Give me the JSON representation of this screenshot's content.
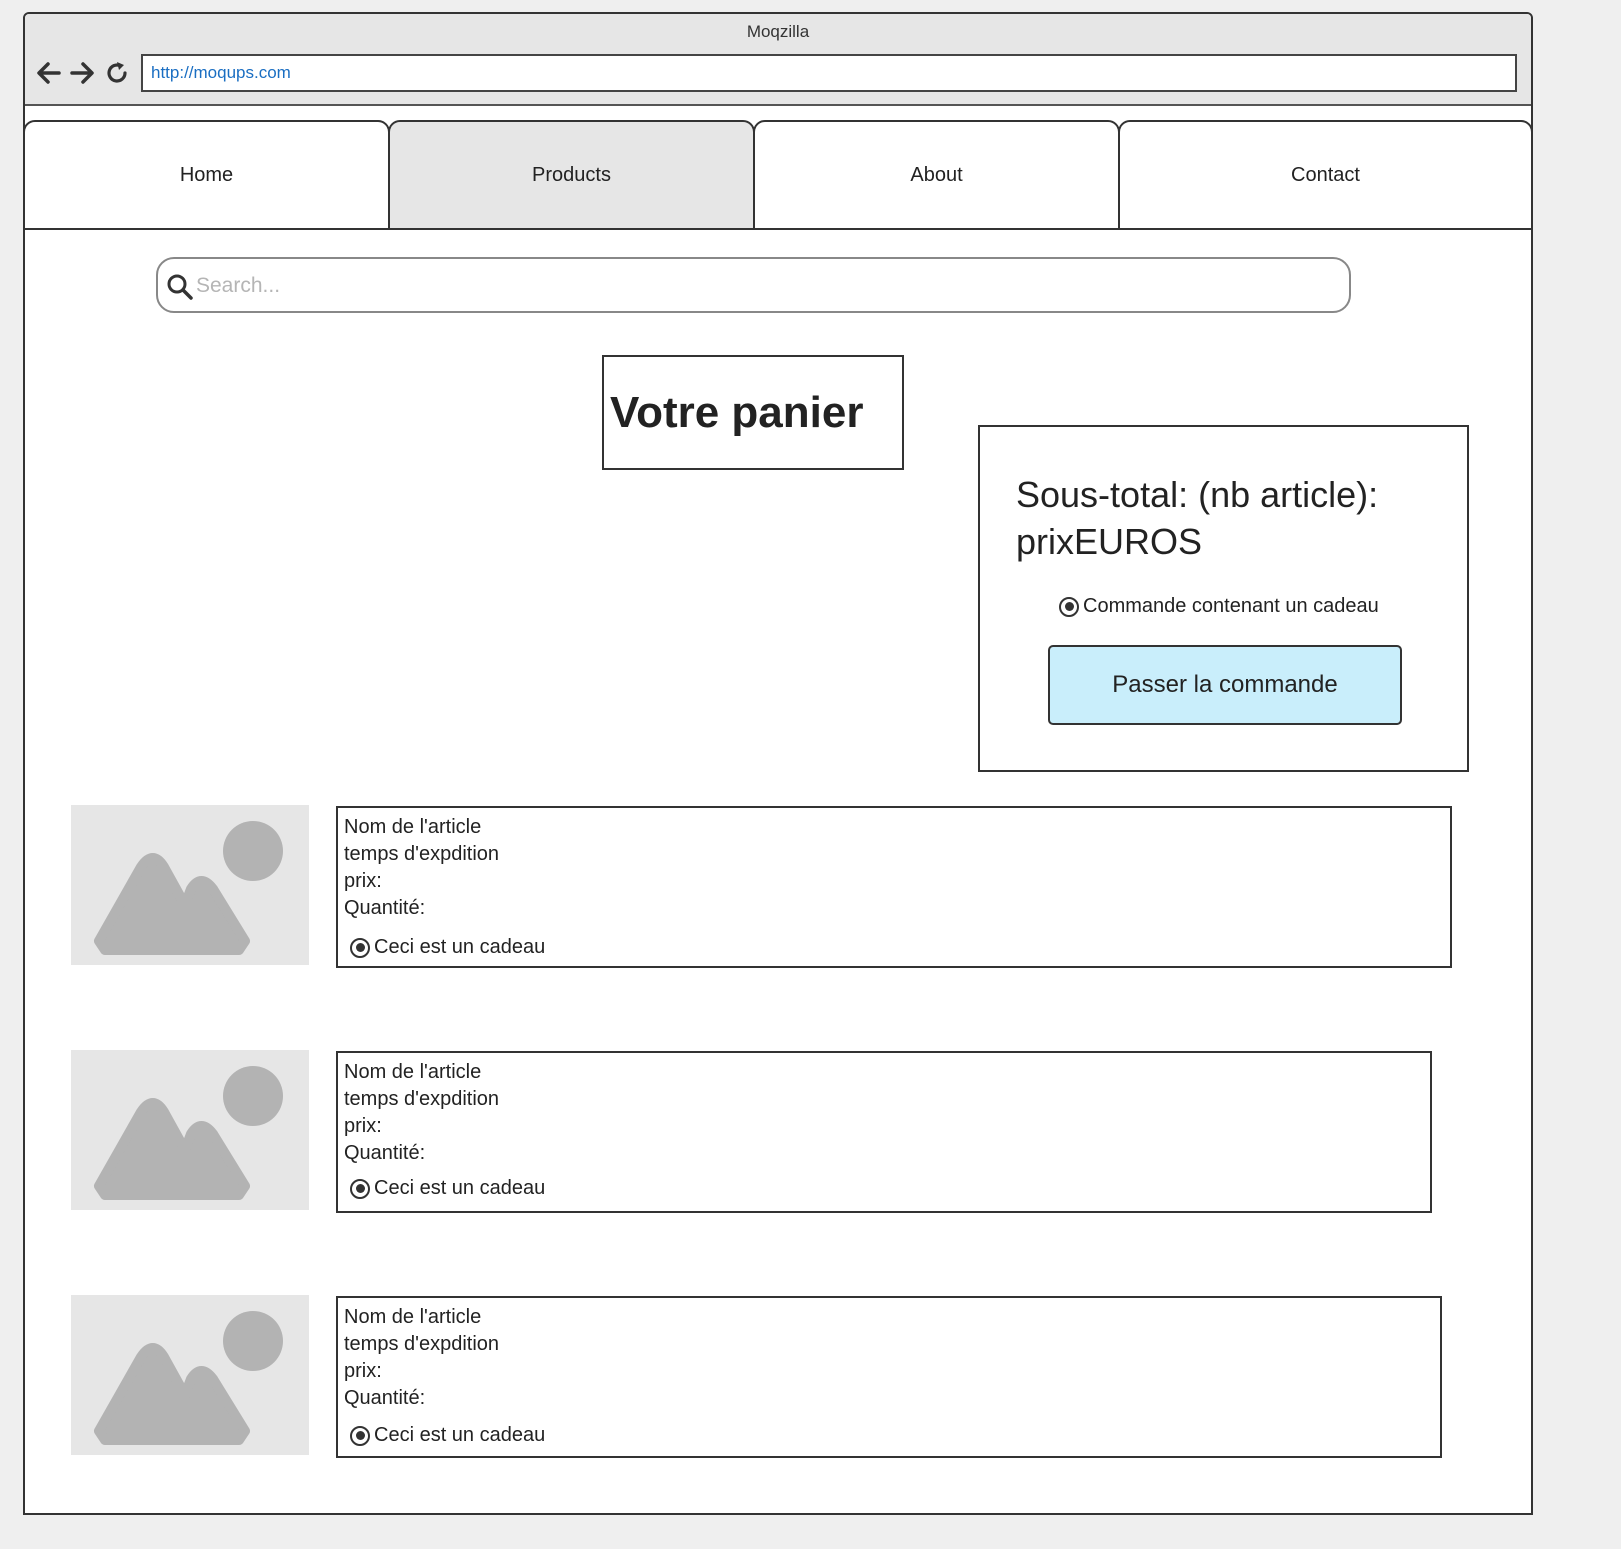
{
  "window": {
    "title": "Moqzilla"
  },
  "browser": {
    "url": "http://moqups.com",
    "back_icon": "arrow-left-icon",
    "forward_icon": "arrow-right-icon",
    "reload_icon": "reload-icon"
  },
  "nav": {
    "tabs": [
      {
        "label": "Home",
        "active": false
      },
      {
        "label": "Products",
        "active": true
      },
      {
        "label": "About",
        "active": false
      },
      {
        "label": "Contact",
        "active": false
      }
    ]
  },
  "search": {
    "placeholder": "Search...",
    "value": ""
  },
  "cart": {
    "title": "Votre panier",
    "summary": {
      "subtotal_line1": "Sous-total: (nb article):",
      "subtotal_line2": "prixEUROS",
      "gift_option_label": "Commande contenant un cadeau",
      "gift_option_selected": true,
      "order_button_label": "Passer la commande"
    },
    "items": [
      {
        "name": "Nom de l'article",
        "shipping": "temps d'expdition",
        "price": "prix:",
        "quantity": "Quantité:",
        "gift_label": "Ceci est un cadeau",
        "gift_selected": true
      },
      {
        "name": "Nom de l'article",
        "shipping": "temps d'expdition",
        "price": "prix:",
        "quantity": "Quantité:",
        "gift_label": "Ceci est un cadeau",
        "gift_selected": true
      },
      {
        "name": "Nom de l'article",
        "shipping": "temps d'expdition",
        "price": "prix:",
        "quantity": "Quantité:",
        "gift_label": "Ceci est un cadeau",
        "gift_selected": true
      }
    ]
  },
  "colors": {
    "accent_button": "#c9eefb",
    "active_tab": "#e6e6e6",
    "url_text": "#1a6ec2",
    "placeholder_image": "#e6e6e6"
  }
}
